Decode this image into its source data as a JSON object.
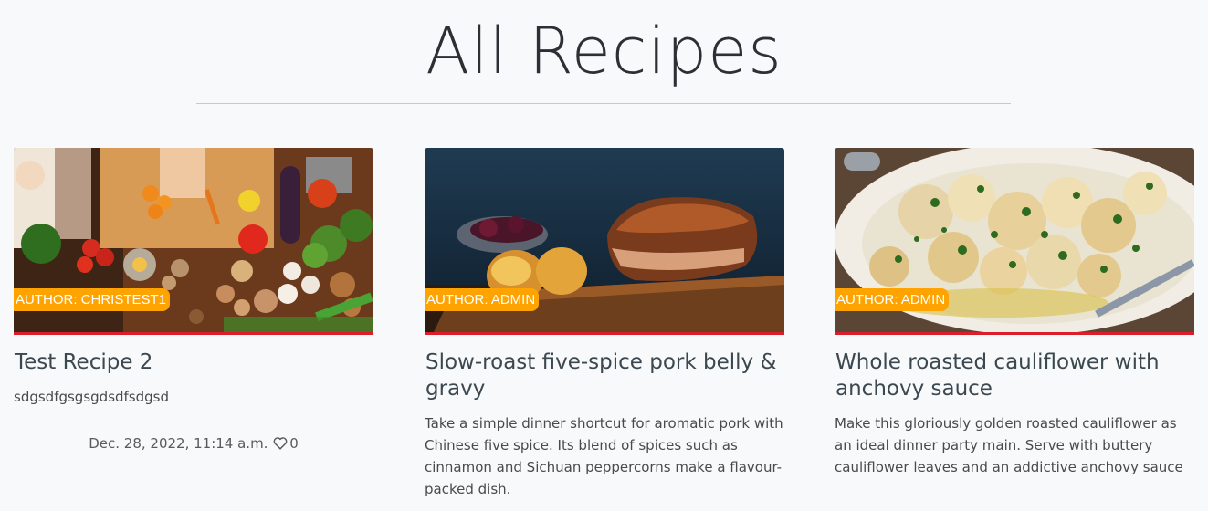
{
  "page": {
    "title": "All Recipes"
  },
  "recipes": [
    {
      "author_badge": "AUTHOR: CHRISTEST1",
      "title": "Test Recipe 2",
      "description": "sdgsdfgsgsgdsdfsdgsd",
      "date": "Dec. 28, 2022, 11:14 a.m.",
      "likes": "0",
      "image_subject": "vegetables-chopping-board"
    },
    {
      "author_badge": "AUTHOR: ADMIN",
      "title": "Slow-roast five-spice pork belly & gravy",
      "description": "Take a simple dinner shortcut for aromatic pork with Chinese five spice. Its blend of spices such as cinnamon and Sichuan peppercorns make a flavour-packed dish.",
      "image_subject": "roast-pork-belly"
    },
    {
      "author_badge": "AUTHOR: ADMIN",
      "title": "Whole roasted cauliflower with anchovy sauce",
      "description": "Make this gloriously golden roasted cauliflower as an ideal dinner party main. Serve with buttery cauliflower leaves and an addictive anchovy sauce",
      "image_subject": "roasted-cauliflower"
    }
  ],
  "colors": {
    "badge": "#ffa300",
    "underline": "#dc1e2b",
    "background": "#f7f9fb"
  },
  "icons": {
    "like": "heart-icon"
  }
}
